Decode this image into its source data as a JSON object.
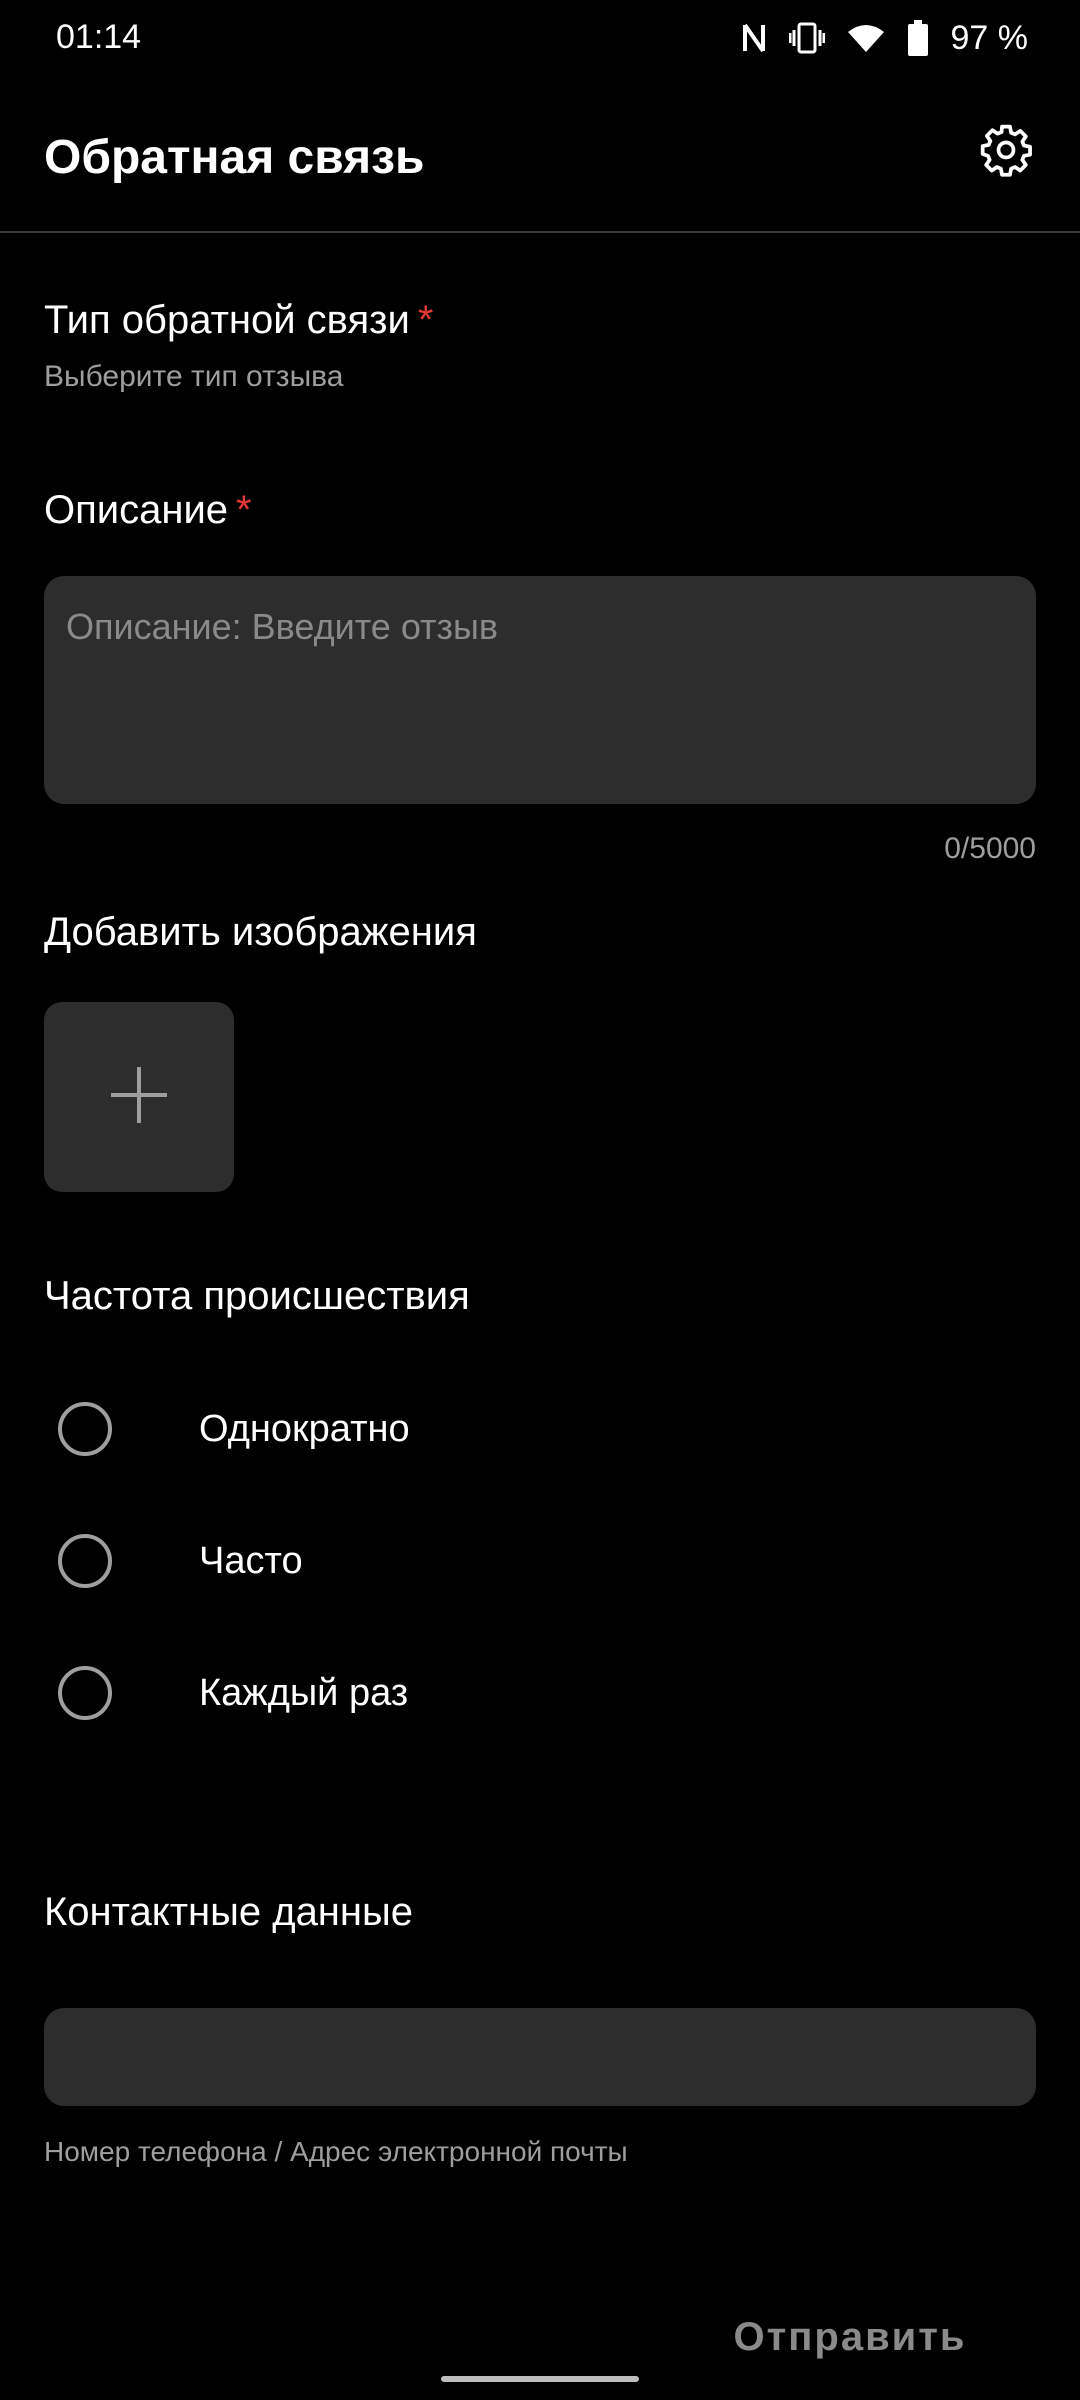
{
  "status_bar": {
    "time": "01:14",
    "battery_percent": "97 %",
    "icons": [
      "nfc-icon",
      "vibrate-icon",
      "wifi-icon",
      "battery-icon"
    ]
  },
  "header": {
    "title": "Обратная связь",
    "settings_icon": "gear-icon"
  },
  "feedback_type": {
    "label": "Тип обратной связи",
    "required_mark": "*",
    "hint": "Выберите тип отзыва"
  },
  "description": {
    "label": "Описание",
    "required_mark": "*",
    "placeholder": "Описание: Введите отзыв",
    "value": "",
    "counter": "0/5000"
  },
  "images": {
    "label": "Добавить изображения",
    "add_icon": "plus-icon"
  },
  "frequency": {
    "label": "Частота происшествия",
    "options": [
      {
        "label": "Однократно",
        "selected": false
      },
      {
        "label": "Часто",
        "selected": false
      },
      {
        "label": "Каждый раз",
        "selected": false
      }
    ]
  },
  "contact": {
    "label": "Контактные данные",
    "value": "",
    "hint": "Номер телефона / Адрес электронной почты"
  },
  "actions": {
    "submit_label": "Отправить"
  },
  "colors": {
    "background": "#000000",
    "field": "#2d2d2d",
    "required": "#e53935",
    "secondary_text": "#9e9e9e"
  }
}
